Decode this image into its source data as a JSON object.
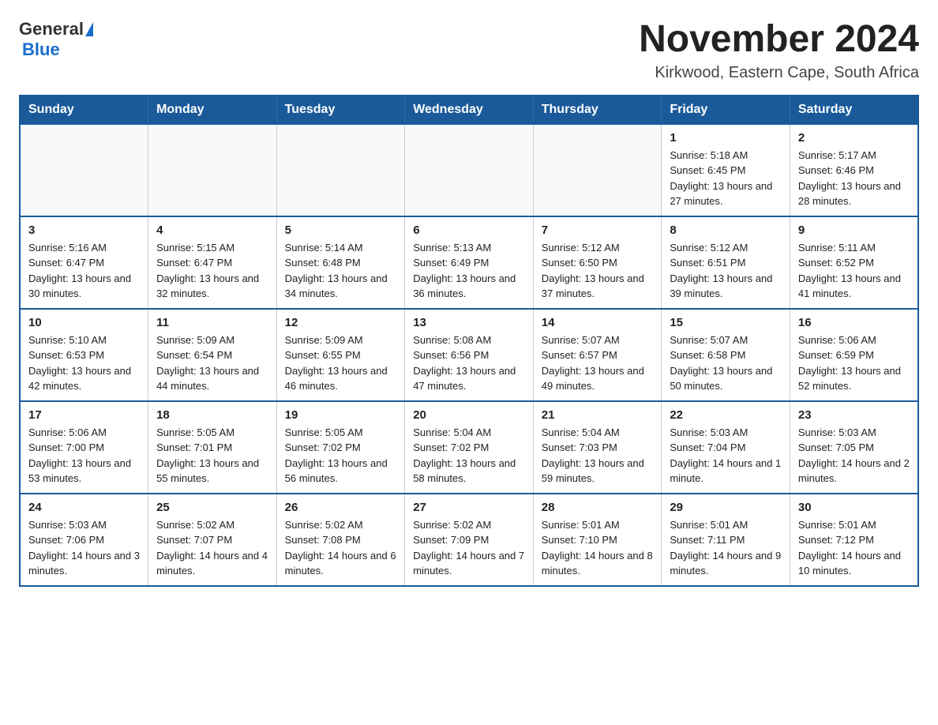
{
  "header": {
    "logo_general": "General",
    "logo_blue": "Blue",
    "month_title": "November 2024",
    "location": "Kirkwood, Eastern Cape, South Africa"
  },
  "days_of_week": [
    "Sunday",
    "Monday",
    "Tuesday",
    "Wednesday",
    "Thursday",
    "Friday",
    "Saturday"
  ],
  "weeks": [
    {
      "days": [
        {
          "num": "",
          "info": ""
        },
        {
          "num": "",
          "info": ""
        },
        {
          "num": "",
          "info": ""
        },
        {
          "num": "",
          "info": ""
        },
        {
          "num": "",
          "info": ""
        },
        {
          "num": "1",
          "info": "Sunrise: 5:18 AM\nSunset: 6:45 PM\nDaylight: 13 hours and 27 minutes."
        },
        {
          "num": "2",
          "info": "Sunrise: 5:17 AM\nSunset: 6:46 PM\nDaylight: 13 hours and 28 minutes."
        }
      ]
    },
    {
      "days": [
        {
          "num": "3",
          "info": "Sunrise: 5:16 AM\nSunset: 6:47 PM\nDaylight: 13 hours and 30 minutes."
        },
        {
          "num": "4",
          "info": "Sunrise: 5:15 AM\nSunset: 6:47 PM\nDaylight: 13 hours and 32 minutes."
        },
        {
          "num": "5",
          "info": "Sunrise: 5:14 AM\nSunset: 6:48 PM\nDaylight: 13 hours and 34 minutes."
        },
        {
          "num": "6",
          "info": "Sunrise: 5:13 AM\nSunset: 6:49 PM\nDaylight: 13 hours and 36 minutes."
        },
        {
          "num": "7",
          "info": "Sunrise: 5:12 AM\nSunset: 6:50 PM\nDaylight: 13 hours and 37 minutes."
        },
        {
          "num": "8",
          "info": "Sunrise: 5:12 AM\nSunset: 6:51 PM\nDaylight: 13 hours and 39 minutes."
        },
        {
          "num": "9",
          "info": "Sunrise: 5:11 AM\nSunset: 6:52 PM\nDaylight: 13 hours and 41 minutes."
        }
      ]
    },
    {
      "days": [
        {
          "num": "10",
          "info": "Sunrise: 5:10 AM\nSunset: 6:53 PM\nDaylight: 13 hours and 42 minutes."
        },
        {
          "num": "11",
          "info": "Sunrise: 5:09 AM\nSunset: 6:54 PM\nDaylight: 13 hours and 44 minutes."
        },
        {
          "num": "12",
          "info": "Sunrise: 5:09 AM\nSunset: 6:55 PM\nDaylight: 13 hours and 46 minutes."
        },
        {
          "num": "13",
          "info": "Sunrise: 5:08 AM\nSunset: 6:56 PM\nDaylight: 13 hours and 47 minutes."
        },
        {
          "num": "14",
          "info": "Sunrise: 5:07 AM\nSunset: 6:57 PM\nDaylight: 13 hours and 49 minutes."
        },
        {
          "num": "15",
          "info": "Sunrise: 5:07 AM\nSunset: 6:58 PM\nDaylight: 13 hours and 50 minutes."
        },
        {
          "num": "16",
          "info": "Sunrise: 5:06 AM\nSunset: 6:59 PM\nDaylight: 13 hours and 52 minutes."
        }
      ]
    },
    {
      "days": [
        {
          "num": "17",
          "info": "Sunrise: 5:06 AM\nSunset: 7:00 PM\nDaylight: 13 hours and 53 minutes."
        },
        {
          "num": "18",
          "info": "Sunrise: 5:05 AM\nSunset: 7:01 PM\nDaylight: 13 hours and 55 minutes."
        },
        {
          "num": "19",
          "info": "Sunrise: 5:05 AM\nSunset: 7:02 PM\nDaylight: 13 hours and 56 minutes."
        },
        {
          "num": "20",
          "info": "Sunrise: 5:04 AM\nSunset: 7:02 PM\nDaylight: 13 hours and 58 minutes."
        },
        {
          "num": "21",
          "info": "Sunrise: 5:04 AM\nSunset: 7:03 PM\nDaylight: 13 hours and 59 minutes."
        },
        {
          "num": "22",
          "info": "Sunrise: 5:03 AM\nSunset: 7:04 PM\nDaylight: 14 hours and 1 minute."
        },
        {
          "num": "23",
          "info": "Sunrise: 5:03 AM\nSunset: 7:05 PM\nDaylight: 14 hours and 2 minutes."
        }
      ]
    },
    {
      "days": [
        {
          "num": "24",
          "info": "Sunrise: 5:03 AM\nSunset: 7:06 PM\nDaylight: 14 hours and 3 minutes."
        },
        {
          "num": "25",
          "info": "Sunrise: 5:02 AM\nSunset: 7:07 PM\nDaylight: 14 hours and 4 minutes."
        },
        {
          "num": "26",
          "info": "Sunrise: 5:02 AM\nSunset: 7:08 PM\nDaylight: 14 hours and 6 minutes."
        },
        {
          "num": "27",
          "info": "Sunrise: 5:02 AM\nSunset: 7:09 PM\nDaylight: 14 hours and 7 minutes."
        },
        {
          "num": "28",
          "info": "Sunrise: 5:01 AM\nSunset: 7:10 PM\nDaylight: 14 hours and 8 minutes."
        },
        {
          "num": "29",
          "info": "Sunrise: 5:01 AM\nSunset: 7:11 PM\nDaylight: 14 hours and 9 minutes."
        },
        {
          "num": "30",
          "info": "Sunrise: 5:01 AM\nSunset: 7:12 PM\nDaylight: 14 hours and 10 minutes."
        }
      ]
    }
  ]
}
